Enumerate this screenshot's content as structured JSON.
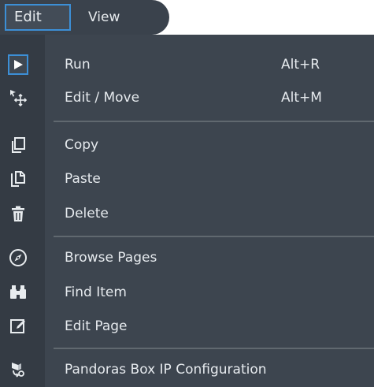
{
  "menubar": {
    "tabs": [
      {
        "label": "Edit"
      },
      {
        "label": "View"
      }
    ]
  },
  "menu": {
    "items": [
      {
        "label": "Run",
        "shortcut": "Alt+R",
        "icon": "play-icon"
      },
      {
        "label": "Edit / Move",
        "shortcut": "Alt+M",
        "icon": "move-icon"
      },
      {
        "label": "Copy",
        "icon": "copy-icon"
      },
      {
        "label": "Paste",
        "icon": "paste-icon"
      },
      {
        "label": "Delete",
        "icon": "trash-icon"
      },
      {
        "label": "Browse Pages",
        "icon": "compass-icon"
      },
      {
        "label": "Find Item",
        "icon": "binoculars-icon"
      },
      {
        "label": "Edit Page",
        "icon": "edit-page-icon"
      },
      {
        "label": "Pandoras Box IP Configuration",
        "icon": "network-config-icon"
      }
    ]
  },
  "colors": {
    "menu_bg": "#3d454f",
    "icon_column_bg": "#343b44",
    "accent": "#3c8fd6",
    "text": "#e6eaee"
  }
}
